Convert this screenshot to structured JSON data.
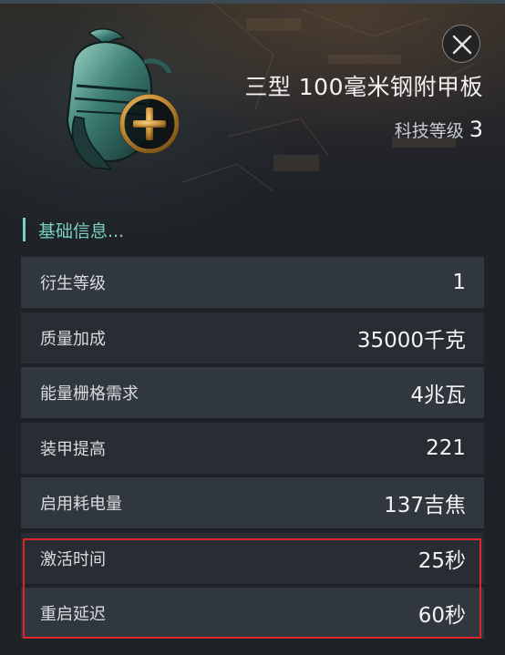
{
  "item": {
    "title": "三型 100毫米钢附甲板",
    "tech_level_label": "科技等级",
    "tech_level_value": "3",
    "icon": "knight-helmet-icon",
    "badge_icon": "plus-icon"
  },
  "close_icon": "close-icon",
  "section": {
    "title": "基础信息..."
  },
  "stats": [
    {
      "label": "衍生等级",
      "value": "1"
    },
    {
      "label": "质量加成",
      "value": "35000千克"
    },
    {
      "label": "能量栅格需求",
      "value": "4兆瓦"
    },
    {
      "label": "装甲提高",
      "value": "221"
    },
    {
      "label": "启用耗电量",
      "value": "137吉焦"
    },
    {
      "label": "激活时间",
      "value": "25秒"
    },
    {
      "label": "重启延迟",
      "value": "60秒"
    }
  ],
  "colors": {
    "accent": "#6fd4c0",
    "highlight": "#e0242d",
    "badge_gold": "#d9a545"
  }
}
